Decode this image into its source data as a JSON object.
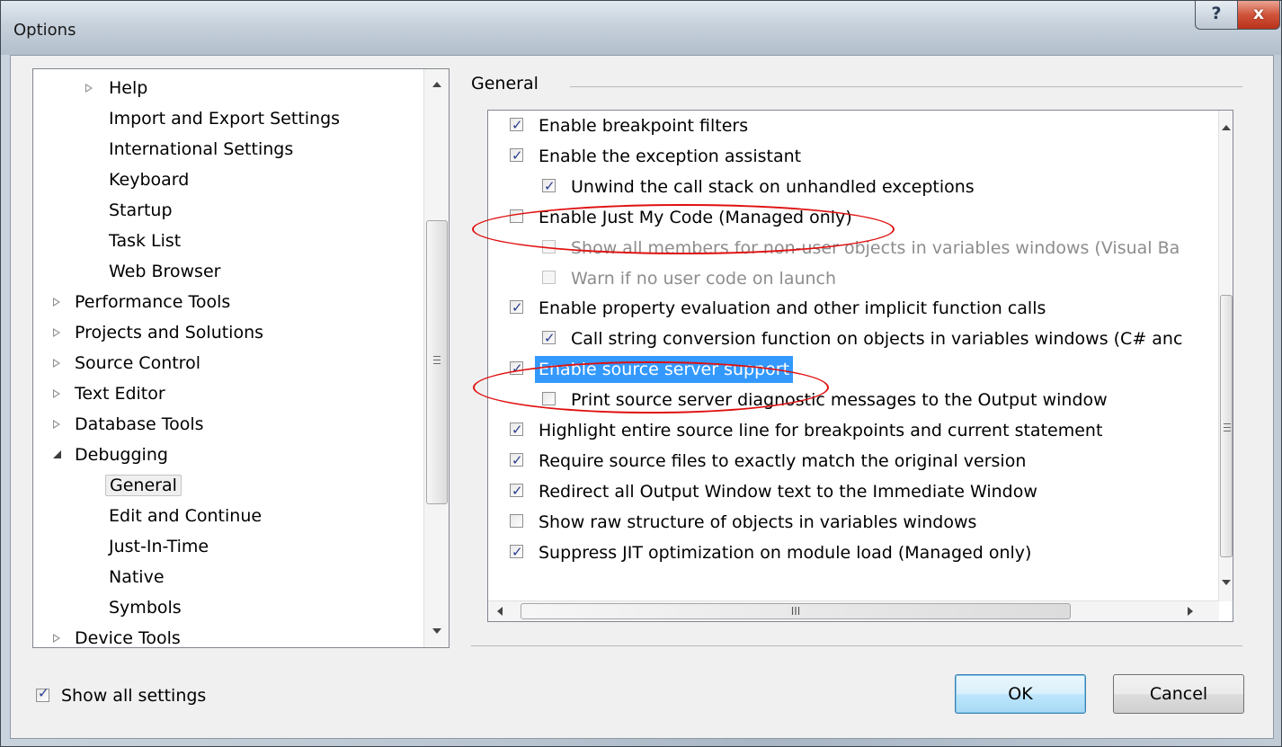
{
  "window": {
    "title": "Options"
  },
  "tree": {
    "items": [
      {
        "label": "Help",
        "expander": "collapsed"
      },
      {
        "label": "Import and Export Settings"
      },
      {
        "label": "International Settings"
      },
      {
        "label": "Keyboard"
      },
      {
        "label": "Startup"
      },
      {
        "label": "Task List"
      },
      {
        "label": "Web Browser"
      },
      {
        "label": "Performance Tools",
        "expander": "collapsed"
      },
      {
        "label": "Projects and Solutions",
        "expander": "collapsed"
      },
      {
        "label": "Source Control",
        "expander": "collapsed"
      },
      {
        "label": "Text Editor",
        "expander": "collapsed"
      },
      {
        "label": "Database Tools",
        "expander": "collapsed"
      },
      {
        "label": "Debugging",
        "expander": "expanded"
      },
      {
        "label": "General",
        "selected": true
      },
      {
        "label": "Edit and Continue"
      },
      {
        "label": "Just-In-Time"
      },
      {
        "label": "Native"
      },
      {
        "label": "Symbols"
      },
      {
        "label": "Device Tools",
        "expander": "collapsed"
      }
    ]
  },
  "general": {
    "heading": "General",
    "options": [
      {
        "label": "Enable breakpoint filters",
        "checked": true
      },
      {
        "label": "Enable the exception assistant",
        "checked": true
      },
      {
        "label": "Unwind the call stack on unhandled exceptions",
        "checked": true
      },
      {
        "label": "Enable Just My Code (Managed only)",
        "checked": false,
        "circled": true
      },
      {
        "label": "Show all members for non-user objects in variables windows (Visual Ba",
        "checked": false,
        "disabled": true
      },
      {
        "label": "Warn if no user code on launch",
        "checked": false,
        "disabled": true
      },
      {
        "label": "Enable property evaluation and other implicit function calls",
        "checked": true
      },
      {
        "label": "Call string conversion function on objects in variables windows (C# anc",
        "checked": true
      },
      {
        "label": "Enable source server support",
        "checked": true,
        "highlighted": true,
        "circled": true
      },
      {
        "label": "Print source server diagnostic messages to the Output window",
        "checked": false
      },
      {
        "label": "Highlight entire source line for breakpoints and current statement",
        "checked": true
      },
      {
        "label": "Require source files to exactly match the original version",
        "checked": true
      },
      {
        "label": "Redirect all Output Window text to the Immediate Window",
        "checked": true
      },
      {
        "label": "Show raw structure of objects in variables windows",
        "checked": false
      },
      {
        "label": "Suppress JIT optimization on module load (Managed only)",
        "checked": true
      }
    ],
    "hscroll_grip": "III"
  },
  "footer": {
    "show_all_label": "Show all settings",
    "show_all_checked": true,
    "ok_label": "OK",
    "cancel_label": "Cancel"
  },
  "caption": {
    "help": "?",
    "close": "x"
  },
  "colors": {
    "highlight": "#3399ff",
    "annotation": "#e01010"
  }
}
